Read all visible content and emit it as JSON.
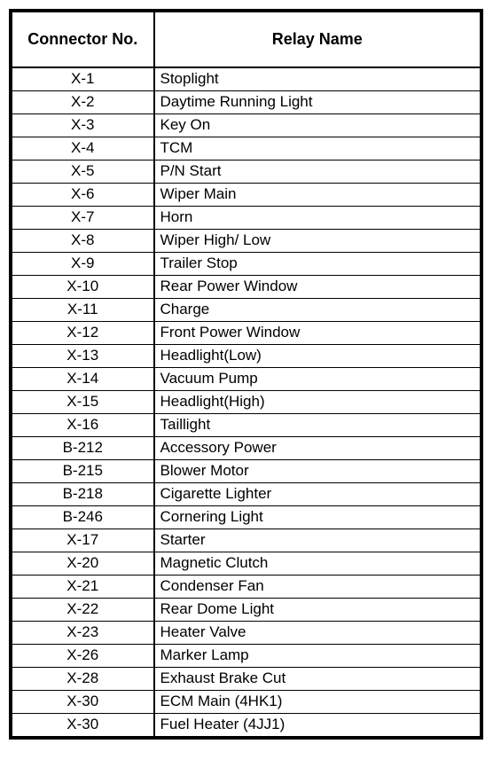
{
  "table": {
    "headers": {
      "connector": "Connector No.",
      "relay": "Relay Name"
    },
    "rows": [
      {
        "connector": "X-1",
        "relay": "Stoplight"
      },
      {
        "connector": "X-2",
        "relay": "Daytime Running Light"
      },
      {
        "connector": "X-3",
        "relay": "Key On"
      },
      {
        "connector": "X-4",
        "relay": "TCM"
      },
      {
        "connector": "X-5",
        "relay": "P/N Start"
      },
      {
        "connector": "X-6",
        "relay": "Wiper Main"
      },
      {
        "connector": "X-7",
        "relay": "Horn"
      },
      {
        "connector": "X-8",
        "relay": "Wiper High/ Low"
      },
      {
        "connector": "X-9",
        "relay": "Trailer Stop"
      },
      {
        "connector": "X-10",
        "relay": "Rear Power Window"
      },
      {
        "connector": "X-11",
        "relay": "Charge"
      },
      {
        "connector": "X-12",
        "relay": "Front Power Window"
      },
      {
        "connector": "X-13",
        "relay": "Headlight(Low)"
      },
      {
        "connector": "X-14",
        "relay": "Vacuum Pump"
      },
      {
        "connector": "X-15",
        "relay": "Headlight(High)"
      },
      {
        "connector": "X-16",
        "relay": "Taillight"
      },
      {
        "connector": "B-212",
        "relay": "Accessory Power"
      },
      {
        "connector": "B-215",
        "relay": "Blower Motor"
      },
      {
        "connector": "B-218",
        "relay": "Cigarette Lighter"
      },
      {
        "connector": "B-246",
        "relay": "Cornering Light"
      },
      {
        "connector": "X-17",
        "relay": "Starter"
      },
      {
        "connector": "X-20",
        "relay": "Magnetic Clutch"
      },
      {
        "connector": "X-21",
        "relay": "Condenser Fan"
      },
      {
        "connector": "X-22",
        "relay": "Rear Dome Light"
      },
      {
        "connector": "X-23",
        "relay": "Heater Valve"
      },
      {
        "connector": "X-26",
        "relay": "Marker Lamp"
      },
      {
        "connector": "X-28",
        "relay": "Exhaust Brake Cut"
      },
      {
        "connector": "X-30",
        "relay": "ECM Main (4HK1)"
      },
      {
        "connector": "X-30",
        "relay": "Fuel Heater (4JJ1)"
      }
    ]
  }
}
